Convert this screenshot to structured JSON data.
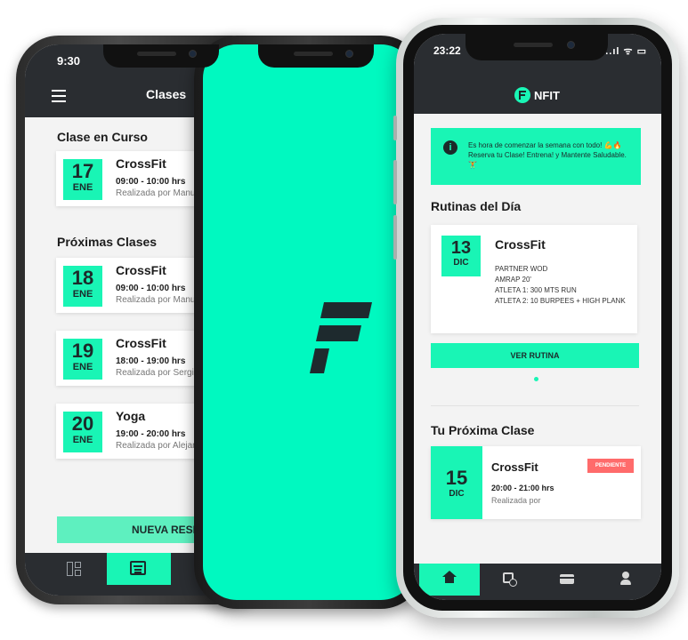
{
  "colors": {
    "accent": "#19F5B5",
    "splash": "#00F9C0",
    "dark": "#2A2D31",
    "badge": "#FF6B6B"
  },
  "phone1": {
    "status_time": "9:30",
    "header_title": "Clases",
    "current_section": "Clase en Curso",
    "current_class": {
      "day": "17",
      "month": "ENE",
      "name": "CrossFit",
      "time": "09:00 - 10:00 hrs",
      "by": "Realizada por Manue"
    },
    "upcoming_section": "Próximas Clases",
    "upcoming_classes": [
      {
        "day": "18",
        "month": "ENE",
        "name": "CrossFit",
        "time": "09:00 - 10:00 hrs",
        "by": "Realizada por Manue"
      },
      {
        "day": "19",
        "month": "ENE",
        "name": "CrossFit",
        "time": "18:00 - 19:00 hrs",
        "by": "Realizada por Sergio"
      },
      {
        "day": "20",
        "month": "ENE",
        "name": "Yoga",
        "time": "19:00 - 20:00 hrs",
        "by": "Realizada por Alejand"
      }
    ],
    "new_booking_button": "NUEVA RESERV",
    "tabs": [
      "dashboard-icon",
      "calendar-icon",
      "card-icon"
    ]
  },
  "phone2": {
    "logo": "nfit-logo"
  },
  "phone3": {
    "status_time": "23:22",
    "status_icons": "..ıl ᯤ ▭",
    "brand": "NFIT",
    "notice": "Es hora de comenzar la semana con todo! 💪🔥 Reserva tu Clase! Entrena! y Mantente Saludable. 🏋",
    "routines_title": "Rutinas del Día",
    "routine": {
      "day": "13",
      "month": "DIC",
      "name": "CrossFit",
      "lines": [
        "PARTNER WOD",
        "AMRAP 20'",
        "ATLETA 1: 300 MTS RUN",
        "ATLETA 2: 10 BURPEES + HIGH PLANK"
      ]
    },
    "view_routine_button": "VER RUTINA",
    "next_class_title": "Tu Próxima Clase",
    "next_class": {
      "day": "15",
      "month": "DIC",
      "name": "CrossFit",
      "status": "PENDIENTE",
      "time": "20:00 - 21:00 hrs",
      "by": "Realizada por"
    },
    "tabs": [
      "home-icon",
      "calendar-clock-icon",
      "card-icon",
      "user-icon"
    ]
  }
}
